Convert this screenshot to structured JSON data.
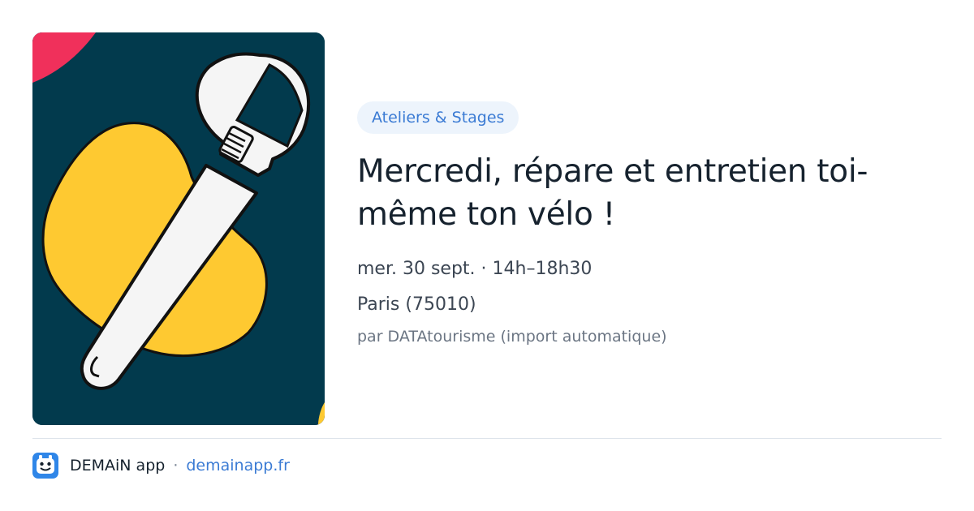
{
  "event": {
    "category": "Ateliers & Stages",
    "title": "Mercredi, répare et entretien toi-même ton vélo !",
    "date": "mer. 30 sept. · 14h–18h30",
    "location": "Paris (75010)",
    "source": "par DATAtourisme (import automatique)"
  },
  "image": {
    "icon": "wrench-illustration",
    "colors": {
      "background": "#023a4d",
      "blob": "#fec931",
      "accent": "#f0305b",
      "wrench": "#f5f5f5"
    }
  },
  "footer": {
    "app_name": "DEMAiN app",
    "separator": "·",
    "site": "demainapp.fr",
    "icon": "demain-app-icon"
  },
  "colors": {
    "badge_bg": "#edf4fc",
    "accent": "#3b7bd4",
    "title": "#16222e"
  }
}
